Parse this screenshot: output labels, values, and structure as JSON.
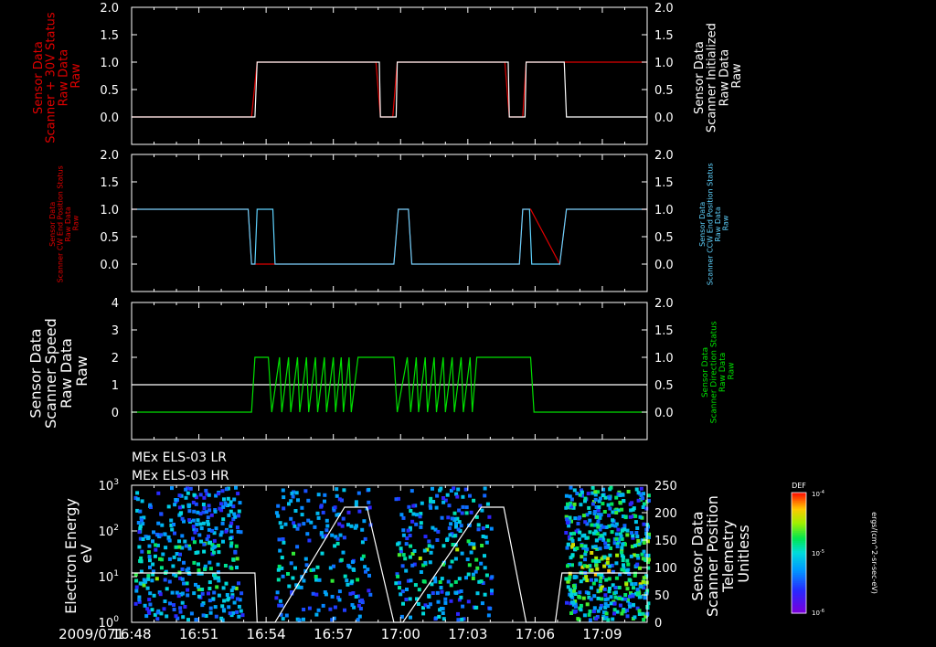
{
  "time_axis": {
    "date_label": "2009/071",
    "tick_labels": [
      "16:48",
      "16:51",
      "16:54",
      "16:57",
      "17:00",
      "17:03",
      "17:06",
      "17:09"
    ],
    "tick_minutes": [
      0,
      3,
      6,
      9,
      12,
      15,
      18,
      21
    ],
    "range_minutes": [
      0,
      23
    ]
  },
  "colors": {
    "white": "#ffffff",
    "red": "#e00000",
    "cyan": "#5fd3ff",
    "green": "#00e000",
    "background": "#000000"
  },
  "chart_data": [
    {
      "type": "line",
      "left_axis": {
        "label_lines": [
          "Sensor Data",
          "Scanner + 30V Status",
          "Raw Data",
          "Raw"
        ],
        "color": "#e00000",
        "ylim": [
          -0.5,
          2.0
        ],
        "ticks": [
          0.0,
          0.5,
          1.0,
          1.5,
          2.0
        ],
        "tick_labels": [
          "0.0",
          "0.5",
          "1.0",
          "1.5",
          "2.0"
        ]
      },
      "right_axis": {
        "label_lines": [
          "Sensor Data",
          "Scanner Initialized",
          "Raw Data",
          "Raw"
        ],
        "color": "#ffffff",
        "ylim": [
          -0.5,
          2.0
        ],
        "ticks": [
          0.0,
          0.5,
          1.0,
          1.5,
          2.0
        ],
        "tick_labels": [
          "0.0",
          "0.5",
          "1.0",
          "1.5",
          "2.0"
        ]
      },
      "series": [
        {
          "axis": "left",
          "color": "#e00000",
          "x": [
            0,
            5.35,
            5.6,
            10.9,
            11.1,
            11.65,
            11.85,
            16.65,
            16.85,
            17.45,
            17.6,
            23
          ],
          "y": [
            0,
            0,
            1,
            1,
            0,
            0,
            1,
            1,
            0,
            0,
            1,
            1
          ]
        },
        {
          "axis": "right",
          "color": "#ffffff",
          "x": [
            0,
            5.5,
            5.6,
            11.05,
            11.1,
            11.8,
            11.85,
            16.8,
            16.85,
            17.55,
            17.6,
            19.3,
            19.4,
            23
          ],
          "y": [
            0,
            0,
            1,
            1,
            0,
            0,
            1,
            1,
            0,
            0,
            1,
            1,
            0,
            0
          ]
        }
      ]
    },
    {
      "type": "line",
      "left_axis": {
        "label_lines": [
          "Sensor Data",
          "Scanner CW End Position Status",
          "Raw Data",
          "Raw"
        ],
        "color": "#e00000",
        "ylim": [
          -0.5,
          2.0
        ],
        "ticks": [
          0.0,
          0.5,
          1.0,
          1.5,
          2.0
        ],
        "tick_labels": [
          "0.0",
          "0.5",
          "1.0",
          "1.5",
          "2.0"
        ]
      },
      "right_axis": {
        "label_lines": [
          "Sensor Data",
          "Scanner CCW End Position Status",
          "Raw Data",
          "Raw"
        ],
        "color": "#5fd3ff",
        "ylim": [
          -0.5,
          2.0
        ],
        "ticks": [
          0.0,
          0.5,
          1.0,
          1.5,
          2.0
        ],
        "tick_labels": [
          "0.0",
          "0.5",
          "1.0",
          "1.5",
          "2.0"
        ]
      },
      "series": [
        {
          "axis": "left",
          "color": "#e00000",
          "x": [
            0,
            5.2,
            5.35,
            6.4,
            11.7,
            11.9,
            12.35,
            12.5,
            17.3,
            17.45,
            17.8,
            19.1,
            19.4,
            23
          ],
          "y": [
            1,
            1,
            0,
            0,
            0,
            1,
            1,
            0,
            0,
            1,
            1,
            0,
            1,
            1
          ]
        },
        {
          "axis": "right",
          "color": "#5fd3ff",
          "x": [
            0,
            5.2,
            5.35,
            5.5,
            5.6,
            6.3,
            6.4,
            11.7,
            11.9,
            12.35,
            12.5,
            17.3,
            17.45,
            17.75,
            17.85,
            19.1,
            19.4,
            23
          ],
          "y": [
            1,
            1,
            0,
            0,
            1,
            1,
            0,
            0,
            1,
            1,
            0,
            0,
            1,
            1,
            0,
            0,
            1,
            1
          ]
        }
      ]
    },
    {
      "type": "line",
      "left_axis": {
        "label_lines": [
          "Sensor Data",
          "Scanner Speed",
          "Raw Data",
          "Raw"
        ],
        "color": "#ffffff",
        "ylim": [
          -1,
          4
        ],
        "ticks": [
          0,
          1,
          2,
          3,
          4
        ],
        "tick_labels": [
          "0",
          "1",
          "2",
          "3",
          "4"
        ]
      },
      "right_axis": {
        "label_lines": [
          "Sensor Data",
          "Scanner Direction Status",
          "Raw Data",
          "Raw"
        ],
        "color": "#00e000",
        "ylim": [
          -0.5,
          2.0
        ],
        "ticks": [
          0.0,
          0.5,
          1.0,
          1.5,
          2.0
        ],
        "tick_labels": [
          "0.0",
          "0.5",
          "1.0",
          "1.5",
          "2.0"
        ]
      },
      "series": [
        {
          "axis": "left",
          "color": "#ffffff",
          "x": [
            0,
            23
          ],
          "y": [
            1,
            1
          ]
        },
        {
          "axis": "right",
          "color": "#00e000",
          "x": [
            0,
            5.35,
            5.5,
            6.1,
            6.25,
            6.6,
            6.7,
            7.0,
            7.1,
            7.4,
            7.5,
            7.8,
            7.9,
            8.2,
            8.3,
            8.6,
            8.7,
            9.0,
            9.1,
            9.35,
            9.45,
            9.7,
            9.8,
            10.1,
            10.2,
            11.7,
            11.85,
            12.3,
            12.45,
            12.7,
            12.8,
            13.1,
            13.2,
            13.5,
            13.6,
            13.9,
            14.0,
            14.3,
            14.4,
            14.7,
            14.8,
            15.1,
            15.2,
            15.4,
            15.5,
            17.8,
            17.95,
            23
          ],
          "y": [
            0,
            0,
            1,
            1,
            0,
            1,
            0,
            1,
            0,
            1,
            0,
            1,
            0,
            1,
            0,
            1,
            0,
            1,
            0,
            1,
            0,
            1,
            0,
            1,
            1,
            1,
            0,
            1,
            0,
            1,
            0,
            1,
            0,
            1,
            0,
            1,
            0,
            1,
            0,
            1,
            0,
            1,
            0,
            1,
            1,
            1,
            0,
            0
          ]
        }
      ]
    },
    {
      "type": "heatmap",
      "titles": [
        "MEx ELS-03 LR",
        "MEx ELS-03 HR"
      ],
      "left_axis": {
        "label_lines": [
          "Electron Energy",
          "eV"
        ],
        "color": "#ffffff",
        "scale": "log",
        "ylim": [
          1,
          1000
        ],
        "ticks": [
          1,
          10,
          100,
          1000
        ],
        "tick_labels": [
          "10^0",
          "10^1",
          "10^2",
          "10^3"
        ]
      },
      "right_axis": {
        "label_lines": [
          "Sensor Data",
          "Scanner Position",
          "Telemetry",
          "Unitless"
        ],
        "color": "#ffffff",
        "ylim": [
          0,
          250
        ],
        "ticks": [
          0,
          50,
          100,
          150,
          200,
          250
        ],
        "tick_labels": [
          "0",
          "50",
          "100",
          "150",
          "200",
          "250"
        ]
      },
      "scanner_position": {
        "x": [
          0,
          5.5,
          5.6,
          6.4,
          9.5,
          10.5,
          11.7,
          12.1,
          15.6,
          16.6,
          17.6,
          18.9,
          19.2,
          23
        ],
        "y": [
          90,
          90,
          0,
          0,
          210,
          210,
          0,
          0,
          210,
          210,
          0,
          0,
          90,
          90
        ]
      },
      "density_regions": [
        {
          "t": [
            0.1,
            4.9
          ],
          "level": 0.35,
          "count": 380
        },
        {
          "t": [
            6.35,
            10.6
          ],
          "level": 0.3,
          "count": 190
        },
        {
          "t": [
            11.7,
            16.0
          ],
          "level": 0.4,
          "count": 240
        },
        {
          "t": [
            19.3,
            23.0
          ],
          "level": 0.55,
          "count": 520
        }
      ],
      "colorbar": {
        "title": "DEF",
        "tick_labels": [
          "10^-4",
          "10^-5",
          "10^-6"
        ],
        "units": "ergs/(cm^2-sr-sec-eV)"
      }
    }
  ]
}
